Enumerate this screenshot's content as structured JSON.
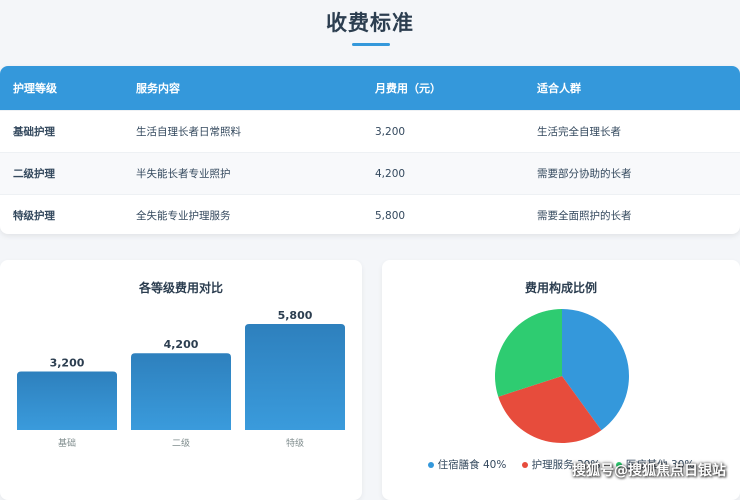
{
  "page": {
    "title": "收费标准"
  },
  "table": {
    "headers": [
      "护理等级",
      "服务内容",
      "月费用（元）",
      "适合人群"
    ],
    "rows": [
      [
        "基础护理",
        "生活自理长者日常照料",
        "3,200",
        "生活完全自理长者"
      ],
      [
        "二级护理",
        "半失能长者专业照护",
        "4,200",
        "需要部分协助的长者"
      ],
      [
        "特级护理",
        "全失能专业护理服务",
        "5,800",
        "需要全面照护的长者"
      ]
    ]
  },
  "bar_card": {
    "title": "各等级费用对比"
  },
  "pie_card": {
    "title": "费用构成比例"
  },
  "chart_data": [
    {
      "type": "bar",
      "title": "各等级费用对比",
      "categories": [
        "基础",
        "二级",
        "特级"
      ],
      "values": [
        3200,
        4200,
        5800
      ],
      "value_labels": [
        "3,200",
        "4,200",
        "5,800"
      ],
      "ylim": [
        0,
        5800
      ],
      "grid": false,
      "colors": {
        "top": "#2e80bd",
        "bottom": "#3a9bdc"
      }
    },
    {
      "type": "pie",
      "title": "费用构成比例",
      "legend_position": "bottom",
      "slices": [
        {
          "label": "住宿膳食",
          "value": 40,
          "display": "住宿膳食 40%",
          "color": "#3498db"
        },
        {
          "label": "护理服务",
          "value": 30,
          "display": "护理服务 30%",
          "color": "#e74c3c"
        },
        {
          "label": "医疗其他",
          "value": 30,
          "display": "医疗其他 30%",
          "color": "#2ecc71"
        }
      ]
    }
  ],
  "watermark": {
    "text": "搜狐号@搜狐焦点日银站"
  }
}
